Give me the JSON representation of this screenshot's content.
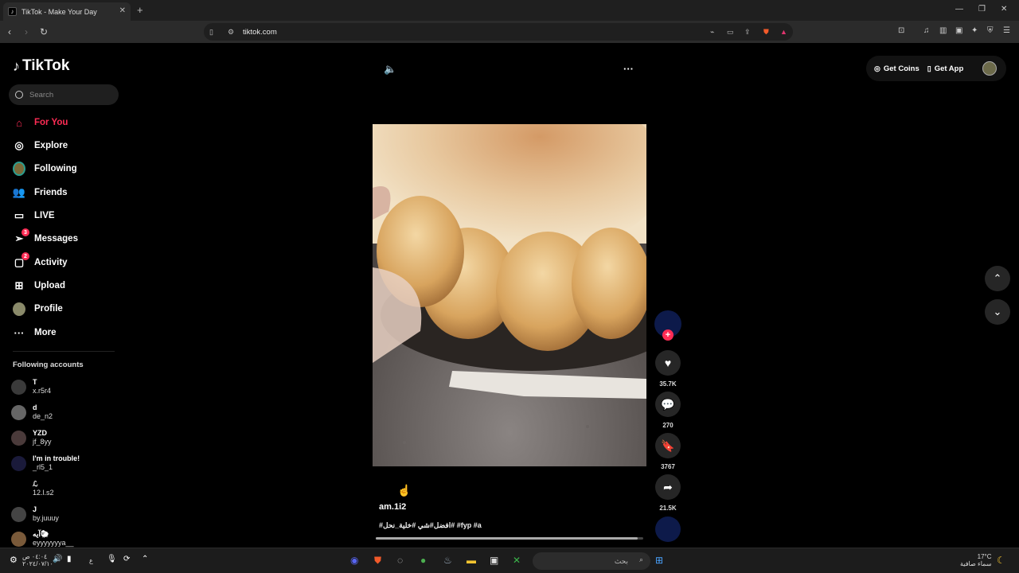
{
  "browser": {
    "tab_title": "TikTok - Make Your Day",
    "url": "tiktok.com"
  },
  "sidebar": {
    "logo": "TikTok",
    "search_placeholder": "Search",
    "items": [
      {
        "label": "For You",
        "icon": "home-icon"
      },
      {
        "label": "Explore",
        "icon": "compass-icon"
      },
      {
        "label": "Following",
        "icon": "following-avatar-icon"
      },
      {
        "label": "Friends",
        "icon": "friends-icon"
      },
      {
        "label": "LIVE",
        "icon": "live-icon"
      },
      {
        "label": "Messages",
        "icon": "messages-icon",
        "badge": "3"
      },
      {
        "label": "Activity",
        "icon": "activity-icon",
        "badge": "2"
      },
      {
        "label": "Upload",
        "icon": "upload-icon"
      },
      {
        "label": "Profile",
        "icon": "profile-icon"
      },
      {
        "label": "More",
        "icon": "more-icon"
      }
    ],
    "following_title": "Following accounts",
    "accounts": [
      {
        "name": "T",
        "username": "x.r5r4"
      },
      {
        "name": "d",
        "username": "de_n2"
      },
      {
        "name": "YZD",
        "username": "jf_8yy"
      },
      {
        "name": "I'm in trouble!",
        "username": "_rl5_1"
      },
      {
        "name": "ℒ",
        "username": "12.l.s2"
      },
      {
        "name": "J",
        "username": "by.juuuy"
      },
      {
        "name": "آيه🐑",
        "username": "eyyyyyyya__"
      }
    ]
  },
  "header": {
    "get_coins": "Get Coins",
    "get_app": "Get App"
  },
  "video": {
    "author": "am.1i2",
    "caption": "#افضل#شي #خلية_نحل# #fyp #a",
    "progress": 0.98,
    "likes": "35.7K",
    "comments": "270",
    "saves": "3767",
    "shares": "21.5K"
  },
  "taskbar": {
    "time": "٠٤:٠٤ ص",
    "date": "٢٠٢٤/٠٧/١٠",
    "lang": "ع",
    "search_label": "بحث",
    "weather_temp": "17°C",
    "weather_desc": "سماء صافية"
  },
  "colors": {
    "accent": "#fe2c55",
    "background": "#000000"
  }
}
